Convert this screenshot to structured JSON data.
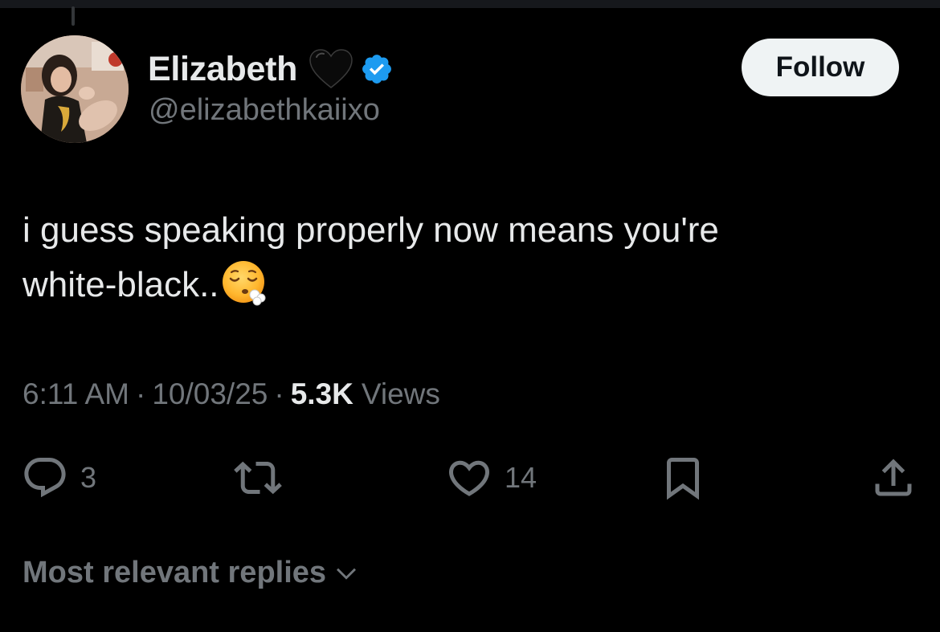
{
  "author": {
    "display_name": "Elizabeth",
    "name_emoji": "black-heart",
    "verified": true,
    "handle": "@elizabethkaiixo"
  },
  "follow_button": {
    "label": "Follow"
  },
  "tweet": {
    "text_line_1": "i guess speaking properly now means you're",
    "text_line_2": "white-black..",
    "text_emoji": "face-exhaling"
  },
  "meta": {
    "time": "6:11 AM",
    "separator": "·",
    "date": "10/03/25",
    "views_count": "5.3K",
    "views_label": "Views"
  },
  "actions": {
    "reply_count": "3",
    "retweet_count": "",
    "like_count": "14"
  },
  "replies_sort": {
    "label": "Most relevant replies"
  },
  "icons": {
    "reply": "reply-icon",
    "retweet": "retweet-icon",
    "like": "heart-icon",
    "bookmark": "bookmark-icon",
    "share": "share-icon",
    "chevron": "chevron-down-icon"
  },
  "colors": {
    "background": "#000000",
    "text_primary": "#e7e9ea",
    "text_secondary": "#71767b",
    "verified_blue": "#1d9bf0",
    "follow_bg": "#eff3f4"
  }
}
